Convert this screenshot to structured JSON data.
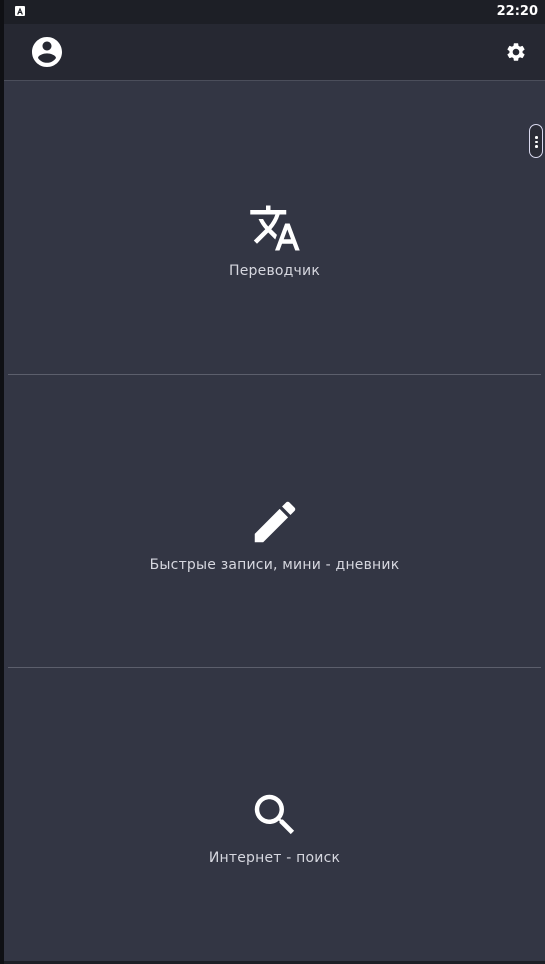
{
  "status_bar": {
    "time": "22:20",
    "app_icon": "app-notification-icon"
  },
  "app_bar": {
    "account_icon": "account-circle-icon",
    "settings_icon": "gear-icon"
  },
  "side_handle": {
    "icon": "more-vert-icon"
  },
  "tiles": [
    {
      "icon": "translate-icon",
      "label": "Переводчик"
    },
    {
      "icon": "pencil-icon",
      "label": "Быстрые записи, мини - дневник"
    },
    {
      "icon": "search-icon",
      "label": "Интернет - поиск"
    }
  ],
  "colors": {
    "background": "#333644",
    "app_bar": "#262832",
    "status_bar": "#1d1f26",
    "text": "#d6d7df",
    "icon": "#ffffff",
    "divider": "#5c5f6c"
  }
}
